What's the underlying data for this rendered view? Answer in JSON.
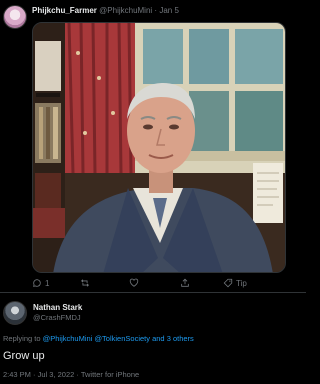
{
  "tweet": {
    "author_name": "Phijkchu_Farmer",
    "author_handle": "@PhijkchuMini",
    "separator": "·",
    "date": "Jan 5",
    "actions": {
      "reply_count": "1",
      "tip_label": "Tip"
    }
  },
  "reply": {
    "author_name": "Nathan Stark",
    "author_handle": "@CrashFMDJ",
    "replying_prefix": "Replying to",
    "mention1": "@PhijkchuMini",
    "mention2": "@TolkienSociety",
    "others": "and 3 others",
    "text": "Grow up",
    "timestamp": "2:43 PM · Jul 3, 2022 · Twitter for iPhone"
  },
  "colors": {
    "background": "#000000",
    "text_primary": "#e7e9ea",
    "text_secondary": "#71767b",
    "link": "#1d9bf0"
  }
}
